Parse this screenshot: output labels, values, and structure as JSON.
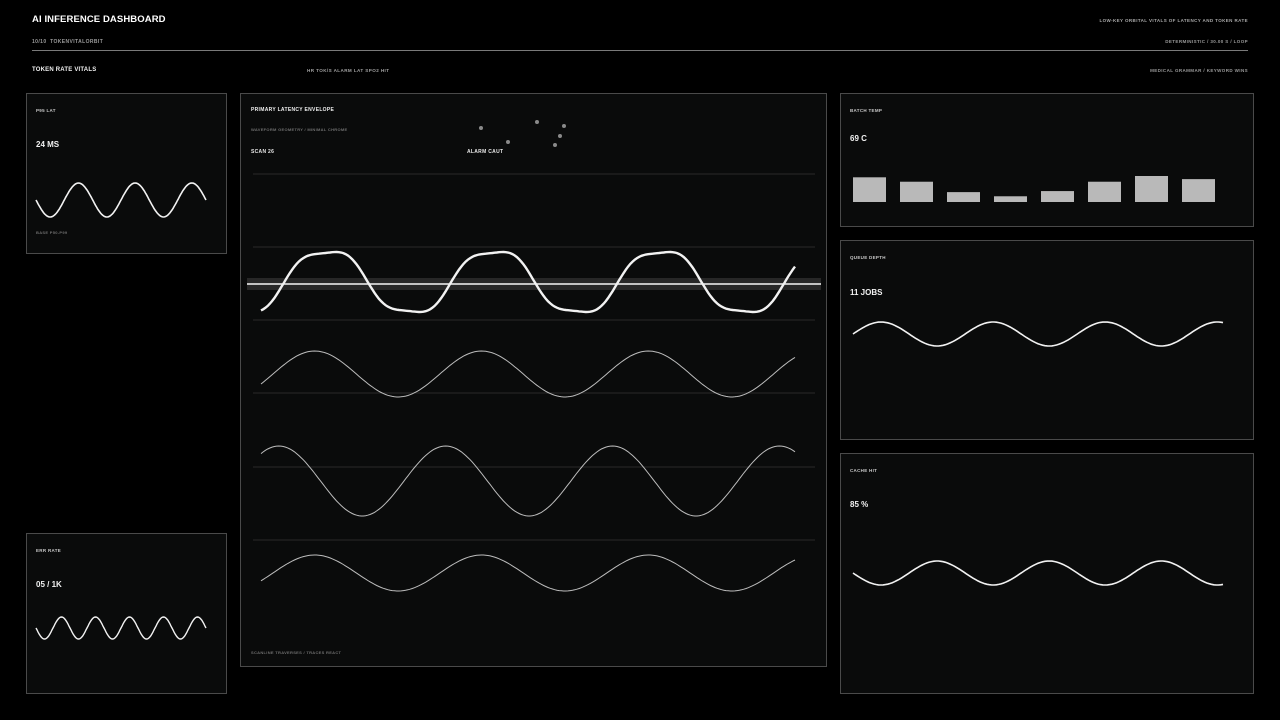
{
  "header": {
    "title": "AI INFERENCE DASHBOARD",
    "subtitle": "LOW-KEY ORBITAL VITALS OF LATENCY AND TOKEN RATE",
    "counter": "10/10",
    "app_name": "TOKENVITALORBIT",
    "mode": "DETERMINISTIC / 30.00 S / LOOP"
  },
  "subheader": {
    "section": "TOKEN RATE VITALS",
    "channels": "HR TOK/S  ALARM LAT  SPO2 HIT",
    "grammar": "MEDICAL GRAMMAR / KEYWORD WINS"
  },
  "panels": {
    "p95": {
      "label": "P95 LAT",
      "value": "24 MS",
      "sub": "BASE P50-P99",
      "wave": {
        "cycles": 3,
        "amp": 1.0
      }
    },
    "err": {
      "label": "ERR RATE",
      "value": "05 / 1K",
      "wave": {
        "cycles": 5,
        "amp": 1.0
      }
    },
    "main": {
      "title": "PRIMARY  LATENCY ENVELOPE",
      "subtitle": "WAVEFORM GEOMETRY / MINIMAL CHROME",
      "scan": "SCAN 26",
      "alarm": "ALARM CAUT",
      "footer": "SCANLINE TRAVERSES / TRACES REACT",
      "traces": [
        {
          "cycles": 3.2,
          "primary": true
        },
        {
          "cycles": 3.2
        },
        {
          "cycles": 3.2
        },
        {
          "cycles": 3.2
        }
      ]
    },
    "batch": {
      "label": "BATCH TEMP",
      "value": "69 C",
      "bars": [
        0.95,
        0.78,
        0.38,
        0.22,
        0.42,
        0.78,
        1.0,
        0.88
      ]
    },
    "queue": {
      "label": "QUEUE DEPTH",
      "value": "11 JOBS",
      "wave": {
        "cycles": 3.3,
        "amp": 1.0
      }
    },
    "cache": {
      "label": "CACHE HIT",
      "value": "85 %",
      "wave": {
        "cycles": 3.3,
        "amp": 1.0
      }
    }
  },
  "colors": {
    "accent": "#f2f2f2",
    "trace": "#bdbdbd",
    "grid": "#2a2a2a",
    "panel": "#0a0b0b",
    "border": "#4a4a4a"
  }
}
